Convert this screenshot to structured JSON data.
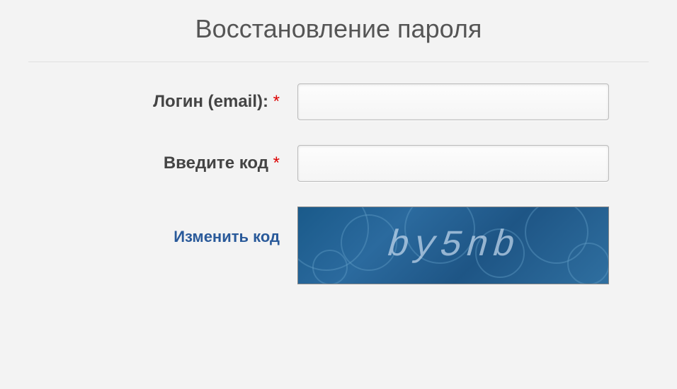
{
  "page": {
    "title": "Восстановление пароля"
  },
  "form": {
    "login": {
      "label": "Логин (email): ",
      "required": "*",
      "value": ""
    },
    "code": {
      "label": "Введите код ",
      "required": "*",
      "value": ""
    }
  },
  "captcha": {
    "change_label": "Изменить код",
    "text": "by5nb"
  }
}
